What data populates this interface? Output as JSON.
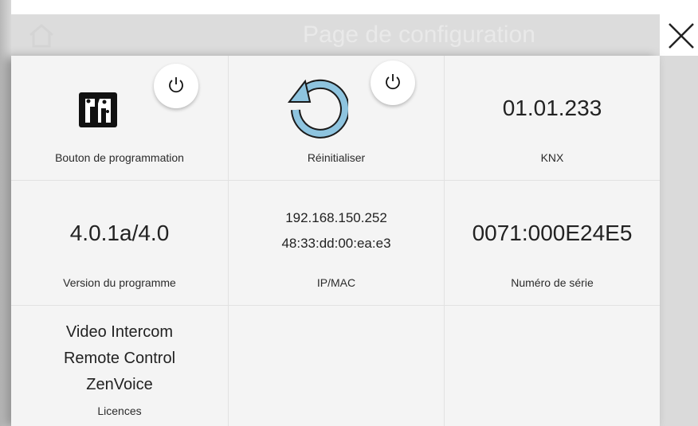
{
  "background_page": {
    "title": "Page de configuration"
  },
  "close": {
    "icon": "close-x-icon"
  },
  "tiles": {
    "programming_button": {
      "icon": "knx-programming-icon",
      "label": "Bouton de programmation",
      "action_icon": "power-icon"
    },
    "reset": {
      "icon": "reset-arrow-icon",
      "label": "Réinitialiser",
      "action_icon": "power-icon"
    },
    "knx": {
      "value": "01.01.233",
      "label": "KNX"
    },
    "program_version": {
      "value": "4.0.1a/4.0",
      "label": "Version du programme"
    },
    "ip_mac": {
      "ip": "192.168.150.252",
      "mac": "48:33:dd:00:ea:e3",
      "label": "IP/MAC"
    },
    "serial": {
      "value": "0071:000E24E5",
      "label": "Numéro de série"
    },
    "licences": {
      "items": [
        "Video Intercom",
        "Remote Control",
        "ZenVoice"
      ],
      "label": "Licences"
    }
  },
  "colors": {
    "reset_icon": "#8ec4df",
    "reset_stroke": "#1a1a1a"
  }
}
